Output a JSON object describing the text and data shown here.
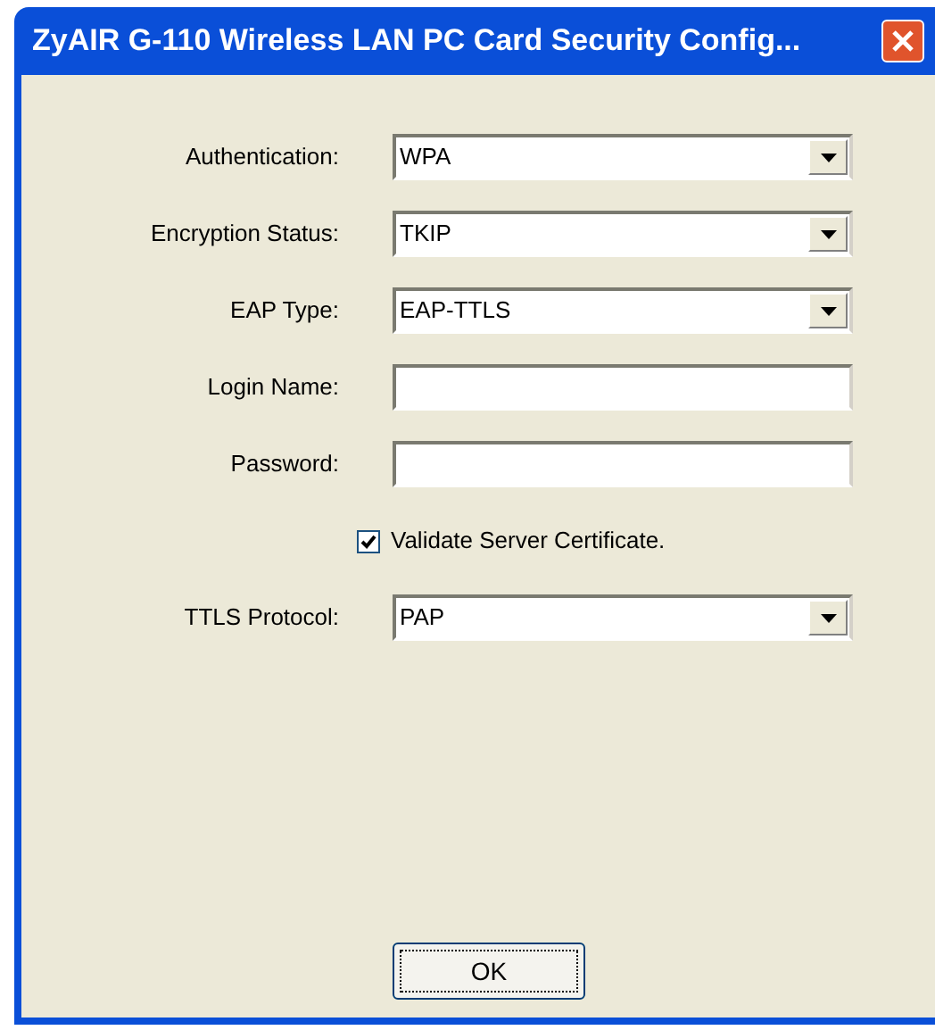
{
  "window": {
    "title": "ZyAIR G-110 Wireless LAN PC Card Security Config..."
  },
  "fields": [
    {
      "kind": "select",
      "label": "Authentication:",
      "value": "WPA"
    },
    {
      "kind": "select",
      "label": "Encryption Status:",
      "value": "TKIP"
    },
    {
      "kind": "select",
      "label": "EAP Type:",
      "value": "EAP-TTLS"
    },
    {
      "kind": "text",
      "label": "Login Name:"
    },
    {
      "kind": "text",
      "label": "Password:"
    },
    {
      "kind": "checkbox",
      "label": "Validate Server Certificate.",
      "checked": true
    },
    {
      "kind": "select",
      "label": "TTLS Protocol:",
      "value": "PAP"
    }
  ],
  "buttons": [
    "OK"
  ]
}
